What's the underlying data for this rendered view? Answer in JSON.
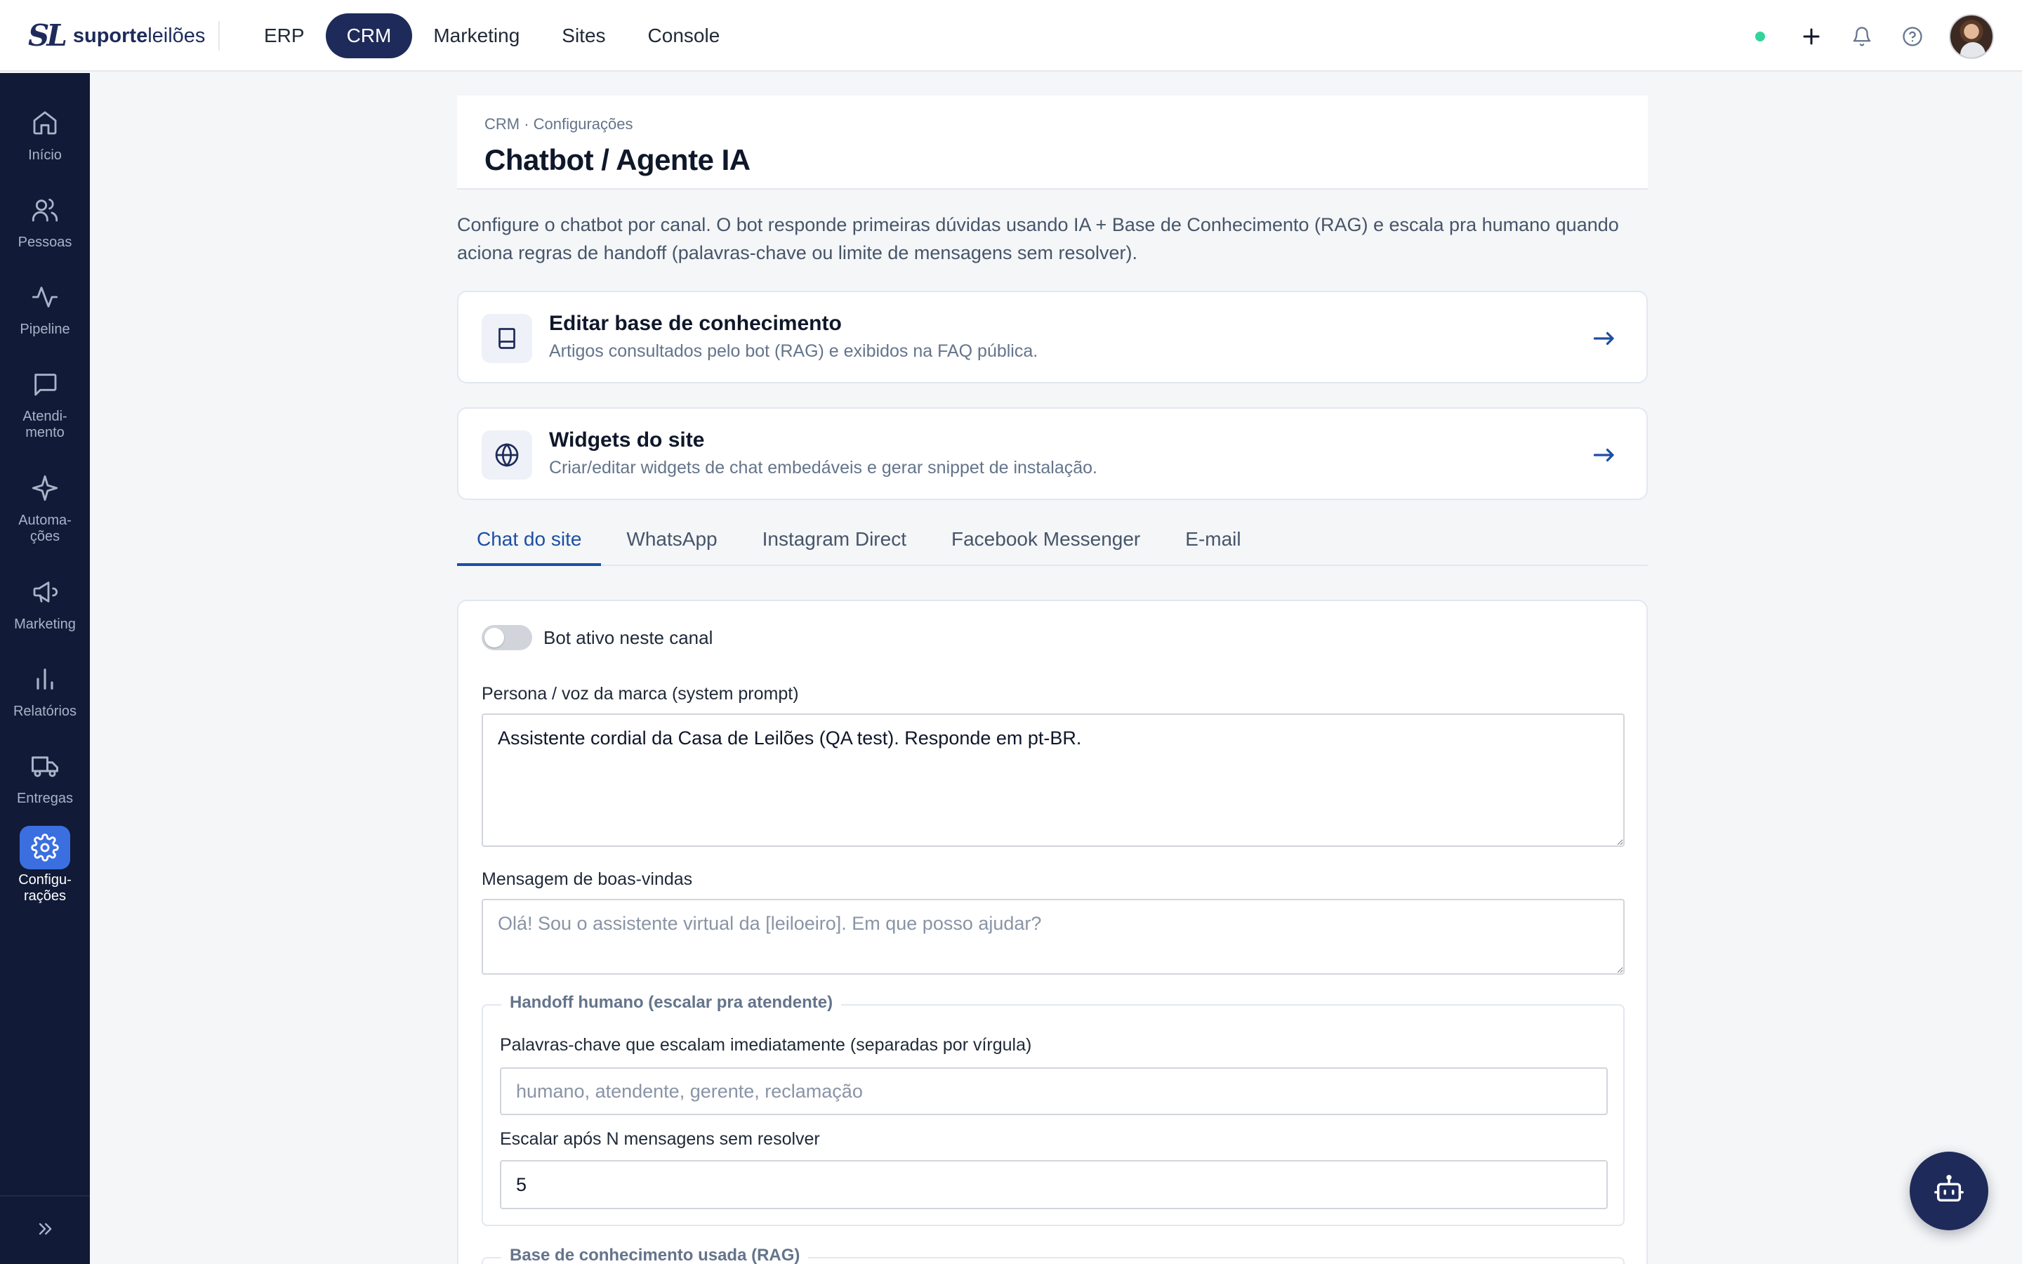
{
  "brand": {
    "mark": "SL",
    "name_bold": "suporte",
    "name_light": "leilões"
  },
  "topnav": {
    "items": [
      {
        "label": "ERP",
        "active": false
      },
      {
        "label": "CRM",
        "active": true
      },
      {
        "label": "Marketing",
        "active": false
      },
      {
        "label": "Sites",
        "active": false
      },
      {
        "label": "Console",
        "active": false
      }
    ]
  },
  "topbar_icons": [
    "online-status-dot",
    "plus-icon",
    "bell-icon",
    "help-icon",
    "user-avatar"
  ],
  "sidebar": {
    "items": [
      {
        "label": "Início",
        "icon": "home-icon",
        "active": false
      },
      {
        "label": "Pessoas",
        "icon": "users-icon",
        "active": false
      },
      {
        "label": "Pipeline",
        "icon": "activity-icon",
        "active": false
      },
      {
        "label": "Atendi-\nmento",
        "icon": "chat-icon",
        "active": false
      },
      {
        "label": "Automa-\nções",
        "icon": "sparkle-icon",
        "active": false
      },
      {
        "label": "Marketing",
        "icon": "megaphone-icon",
        "active": false
      },
      {
        "label": "Relatórios",
        "icon": "bar-chart-icon",
        "active": false
      },
      {
        "label": "Entregas",
        "icon": "truck-icon",
        "active": false
      },
      {
        "label": "Configu-\nrações",
        "icon": "gear-icon",
        "active": true
      }
    ],
    "collapse_icon": "chevrons-right-icon"
  },
  "header": {
    "breadcrumb": "CRM · Configurações",
    "title": "Chatbot / Agente IA"
  },
  "intro": "Configure o chatbot por canal. O bot responde primeiras dúvidas usando IA + Base de Conhecimento (RAG) e escala pra humano quando aciona regras de handoff (palavras-chave ou limite de mensagens sem resolver).",
  "link_cards": [
    {
      "title": "Editar base de conhecimento",
      "subtitle": "Artigos consultados pelo bot (RAG) e exibidos na FAQ pública.",
      "icon": "book-icon"
    },
    {
      "title": "Widgets do site",
      "subtitle": "Criar/editar widgets de chat embedáveis e gerar snippet de instalação.",
      "icon": "globe-icon"
    }
  ],
  "tabs": [
    {
      "label": "Chat do site",
      "active": true
    },
    {
      "label": "WhatsApp",
      "active": false
    },
    {
      "label": "Instagram Direct",
      "active": false
    },
    {
      "label": "Facebook Messenger",
      "active": false
    },
    {
      "label": "E-mail",
      "active": false
    }
  ],
  "form": {
    "bot_active_label": "Bot ativo neste canal",
    "bot_active": false,
    "persona_label": "Persona / voz da marca (system prompt)",
    "persona_value": "Assistente cordial da Casa de Leilões (QA test). Responde em pt-BR.",
    "welcome_label": "Mensagem de boas-vindas",
    "welcome_placeholder": "Olá! Sou o assistente virtual da [leiloeiro]. Em que posso ajudar?",
    "handoff_legend": "Handoff humano (escalar pra atendente)",
    "keywords_label": "Palavras-chave que escalam imediatamente (separadas por vírgula)",
    "keywords_placeholder": "humano, atendente, gerente, reclamação",
    "escalate_label": "Escalar após N mensagens sem resolver",
    "escalate_value": "5",
    "rag_legend": "Base de conhecimento usada (RAG)"
  },
  "fab_icon": "robot-icon",
  "colors": {
    "navy": "#1e2b5a",
    "sidebar": "#111a36",
    "accent": "#1d4fa3",
    "active_sidebar": "#3b6fe0",
    "status_green": "#34d399"
  }
}
